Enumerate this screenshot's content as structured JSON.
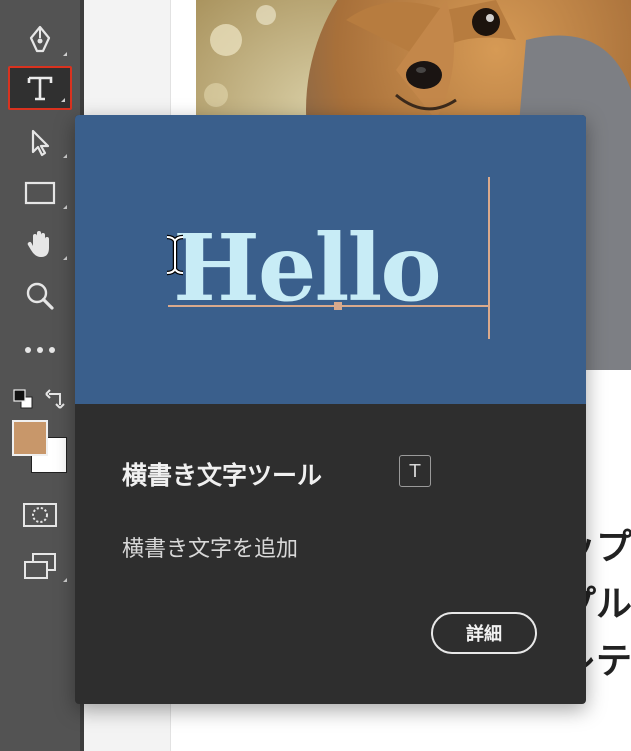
{
  "toolbar": {
    "tools": [
      {
        "name": "pen-tool",
        "icon": "pen-icon"
      },
      {
        "name": "horizontal-type-tool",
        "icon": "type-icon",
        "selected": true
      },
      {
        "name": "selection-tool",
        "icon": "arrow-icon"
      },
      {
        "name": "rectangle-tool",
        "icon": "rectangle-icon"
      },
      {
        "name": "hand-tool",
        "icon": "hand-icon"
      },
      {
        "name": "zoom-tool",
        "icon": "magnifier-icon"
      },
      {
        "name": "edit-toolbar",
        "icon": "more-dots-icon"
      }
    ],
    "foreground_color": "#c8976a",
    "background_color": "#ffffff",
    "selected_outline_color": "#d9321f"
  },
  "document": {
    "partial_text_lines": [
      "ップ",
      "プル",
      "レテ"
    ]
  },
  "tooltip": {
    "preview_word": "Hello",
    "preview_bg": "#3a5f8c",
    "preview_text_color": "#c8ecf6",
    "title": "横書き文字ツール",
    "shortcut": "T",
    "description": "横書き文字を追加",
    "learn_more_label": "詳細"
  }
}
